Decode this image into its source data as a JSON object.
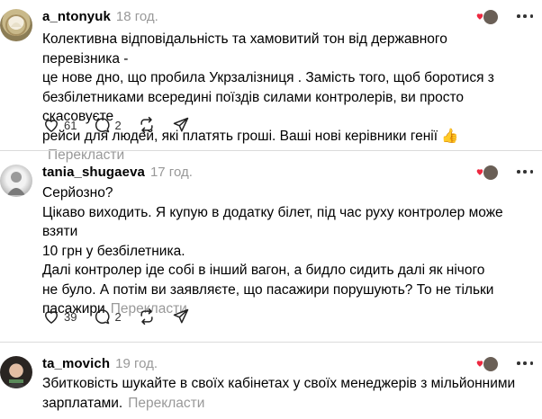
{
  "replies": [
    {
      "username": "a_ntonyuk",
      "time": "18 год.",
      "lines": [
        "Колективна відповідальність та хамовитий тон від державного перевізника -",
        "це нове дно, що пробила Укрзалізниця . Замість того, щоб боротися з",
        "безбілетниками всередині поїздів силами контролерів, ви просто скасовуєте",
        "рейси для людей, які платять гроші. Ваші нові керівники генії 👍"
      ],
      "translate": "Перекласти",
      "likes": "61",
      "comments": "2"
    },
    {
      "username": "tania_shugaeva",
      "time": "17 год.",
      "lines": [
        "Серйозно?",
        "Цікаво виходить. Я купую в додатку білет, під час руху контролер може взяти",
        "10 грн у безбілетника.",
        "Далі контролер іде собі в інший вагон, а бидло сидить далі як нічого",
        "не було. А потім ви заявляєте, що пасажири порушують? То не тільки",
        "пасажири"
      ],
      "translate": "Перекласти",
      "likes": "39",
      "comments": "2"
    },
    {
      "username": "ta_movich",
      "time": "19 год.",
      "lines": [
        "Збитковість шукайте в своїх кабінетах у своїх менеджерів з мільйонними",
        "зарплатами."
      ],
      "translate": "Перекласти"
    }
  ],
  "colors": {
    "heart_red": "#ed2940",
    "muted": "#999999",
    "divider": "#dbdbdb"
  },
  "icons": [
    "heart-icon",
    "comment-icon",
    "repost-icon",
    "share-icon",
    "more-icon"
  ]
}
